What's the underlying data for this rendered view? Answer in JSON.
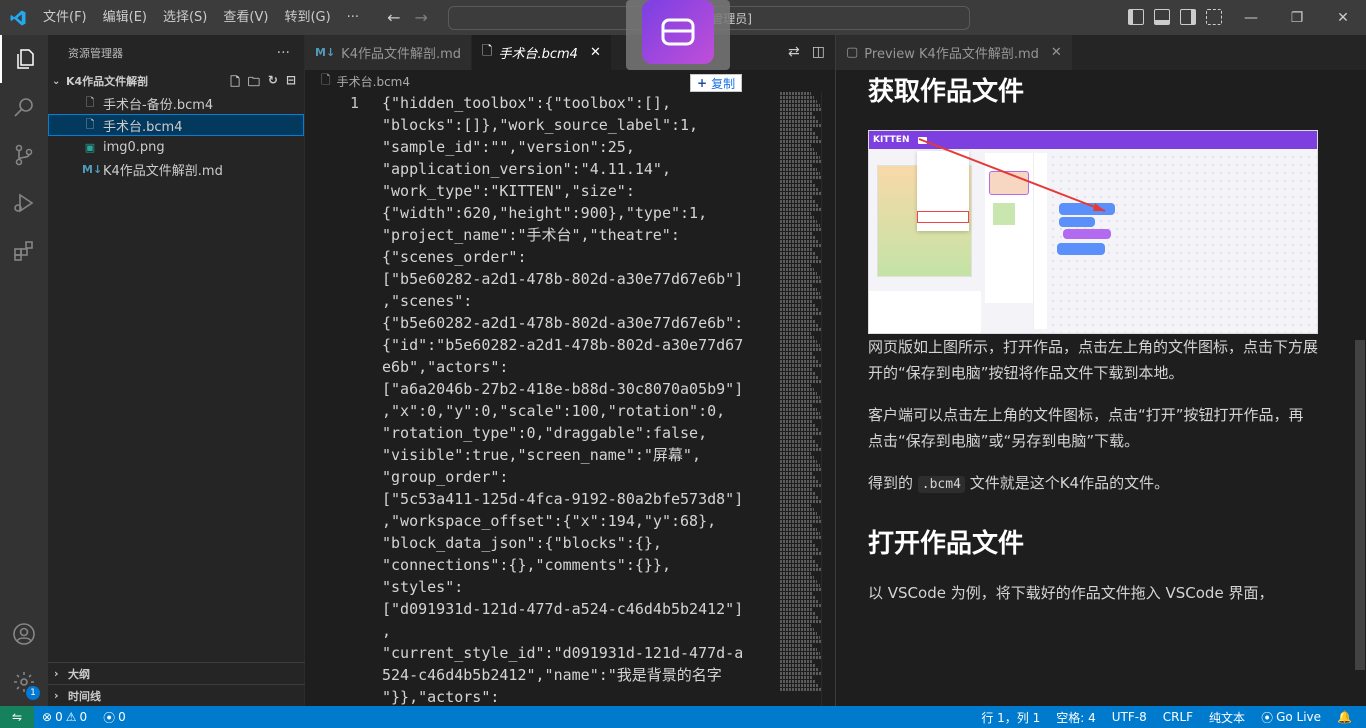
{
  "menu": {
    "items": [
      "文件(F)",
      "编辑(E)",
      "选择(S)",
      "查看(V)",
      "转到(G)"
    ],
    "more": "···"
  },
  "search": {
    "text": "解剖 [管理员]"
  },
  "window": {
    "minimize": "—",
    "restore": "❐",
    "close": "✕"
  },
  "sidebar": {
    "title": "资源管理器",
    "more": "···",
    "folder": "K4作品文件解剖",
    "files": [
      {
        "name": "手术台-备份.bcm4",
        "icon": "file-icon"
      },
      {
        "name": "手术台.bcm4",
        "icon": "file-icon"
      },
      {
        "name": "img0.png",
        "icon": "image-icon"
      },
      {
        "name": "K4作品文件解剖.md",
        "icon": "markdown-icon"
      }
    ],
    "outline": "大纲",
    "timeline": "时间线"
  },
  "activity": {
    "badge": "1"
  },
  "editor": {
    "tabs": [
      {
        "label": "K4作品文件解剖.md",
        "icon": "M↓"
      },
      {
        "label": "手术台.bcm4",
        "icon": "file-icon"
      }
    ],
    "breadcrumb": "手术台.bcm4",
    "line_number": "1",
    "code_lines": [
      "{\"hidden_toolbox\":{\"toolbox\":[],",
      "\"blocks\":[]},\"work_source_label\":1,",
      "\"sample_id\":\"\",\"version\":25,",
      "\"application_version\":\"4.11.14\",",
      "\"work_type\":\"KITTEN\",\"size\":",
      "{\"width\":620,\"height\":900},\"type\":1,",
      "\"project_name\":\"手术台\",\"theatre\":",
      "{\"scenes_order\":",
      "[\"b5e60282-a2d1-478b-802d-a30e77d67e6b\"]",
      ",\"scenes\":",
      "{\"b5e60282-a2d1-478b-802d-a30e77d67e6b\":",
      "{\"id\":\"b5e60282-a2d1-478b-802d-a30e77d67",
      "e6b\",\"actors\":",
      "[\"a6a2046b-27b2-418e-b88d-30c8070a05b9\"]",
      ",\"x\":0,\"y\":0,\"scale\":100,\"rotation\":0,",
      "\"rotation_type\":0,\"draggable\":false,",
      "\"visible\":true,\"screen_name\":\"屏幕\",",
      "\"group_order\":",
      "[\"5c53a411-125d-4fca-9192-80a2bfe573d8\"]",
      ",\"workspace_offset\":{\"x\":194,\"y\":68},",
      "\"block_data_json\":{\"blocks\":{},",
      "\"connections\":{},\"comments\":{}},",
      "\"styles\":",
      "[\"d091931d-121d-477d-a524-c46d4b5b2412\"]",
      ",",
      "\"current_style_id\":\"d091931d-121d-477d-a",
      "524-c46d4b5b2412\",\"name\":\"我是背景的名字",
      "\"}},\"actors\":"
    ]
  },
  "copy_tooltip": {
    "label": "复制"
  },
  "preview": {
    "tab_label": "Preview K4作品文件解剖.md",
    "heading1": "获取作品文件",
    "shot_brand": "KITTEN",
    "para1": "网页版如上图所示，打开作品，点击左上角的文件图标，点击下方展开的“保存到电脑”按钮将作品文件下载到本地。",
    "para2": "客户端可以点击左上角的文件图标，点击“打开”按钮打开作品，再点击“保存到电脑”或“另存到电脑”下载。",
    "para3_before": "得到的 ",
    "para3_code": ".bcm4",
    "para3_after": " 文件就是这个K4作品的文件。",
    "heading2": "打开作品文件",
    "para4": "以 VSCode 为例，将下载好的作品文件拖入 VSCode 界面，"
  },
  "status": {
    "errors": "0",
    "warnings": "0",
    "ports": "0",
    "position": "行 1，列 1",
    "spaces": "空格: 4",
    "encoding": "UTF-8",
    "eol": "CRLF",
    "language": "纯文本",
    "golive": "Go Live"
  },
  "colors": {
    "accent": "#007acc",
    "selection": "#04395e",
    "kitten_purple": "#7e3fe0"
  }
}
